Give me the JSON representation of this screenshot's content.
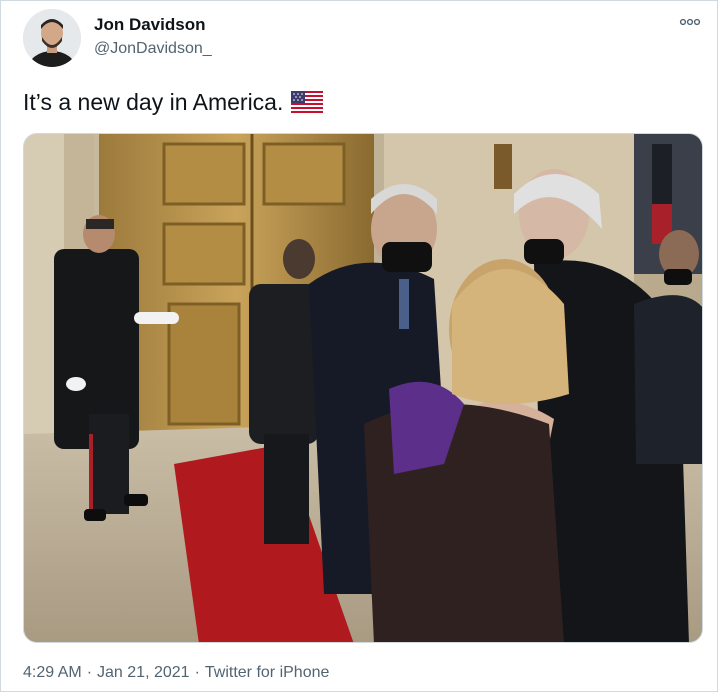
{
  "author": {
    "display_name": "Jon Davidson",
    "handle": "@JonDavidson_",
    "avatar_icon": "user-avatar"
  },
  "tweet": {
    "text": "It’s a new day in America.",
    "emoji": "us-flag-icon"
  },
  "media": {
    "type": "photo",
    "description_icon": "photo"
  },
  "meta": {
    "time": "4:29 AM",
    "separator1": "·",
    "date": "Jan 21, 2021",
    "separator2": "·",
    "source": "Twitter for iPhone"
  },
  "colors": {
    "text_primary": "#0f1419",
    "text_secondary": "#536471",
    "border": "#cfd9de"
  }
}
